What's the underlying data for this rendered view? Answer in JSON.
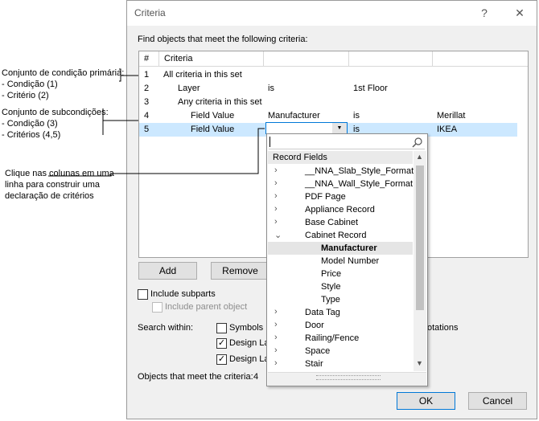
{
  "annotations": {
    "primary_set": {
      "title": "Conjunto de condição primária:",
      "line1": "- Condição (1)",
      "line2": "- Critério (2)"
    },
    "sub_set": {
      "title": "Conjunto de subcondições:",
      "line1": "- Condição (3)",
      "line2": "- Critérios (4,5)"
    },
    "click_note": {
      "line1": "Clique nas colunas em uma",
      "line2": "linha para construir uma",
      "line3": "declaração de critérios"
    }
  },
  "dialog": {
    "title": "Criteria",
    "help_glyph": "?",
    "close_glyph": "✕",
    "instruction": "Find objects that meet the following criteria:",
    "columns": [
      "#",
      "Criteria",
      "",
      "",
      ""
    ],
    "rows": [
      {
        "num": "1",
        "c1": "All criteria in this set",
        "c2": "",
        "c3": "",
        "c4": ""
      },
      {
        "num": "2",
        "c1": "Layer",
        "c2": "is",
        "c3": "1st Floor",
        "c4": ""
      },
      {
        "num": "3",
        "c1": "Any criteria in this set",
        "c2": "",
        "c3": "",
        "c4": ""
      },
      {
        "num": "4",
        "c1": "Field Value",
        "c2": "Manufacturer",
        "c3": "is",
        "c4": "Merillat"
      },
      {
        "num": "5",
        "c1": "Field Value",
        "c2": "",
        "c3": "is",
        "c4": "IKEA"
      }
    ],
    "add_label": "Add",
    "remove_label": "Remove",
    "include_subparts": "Include subparts",
    "include_parent": "Include parent object",
    "search_within": "Search within:",
    "symbols": "Symbols",
    "design_layers_1": "Design La",
    "design_layers_2": "Design La",
    "annotations_partial": "otations",
    "count_label": "Objects that meet the criteria:",
    "count_value": "4",
    "ok_label": "OK",
    "cancel_label": "Cancel"
  },
  "dropdown": {
    "search_value": "",
    "header": "Record Fields",
    "items": [
      {
        "label": "__NNA_Slab_Style_Format",
        "expander": "›"
      },
      {
        "label": "__NNA_Wall_Style_Format",
        "expander": "›"
      },
      {
        "label": "PDF Page",
        "expander": "›"
      },
      {
        "label": "Appliance Record",
        "expander": "›"
      },
      {
        "label": "Base Cabinet",
        "expander": "›"
      },
      {
        "label": "Cabinet Record",
        "expander": "⌄"
      },
      {
        "label": "Manufacturer",
        "expander": ""
      },
      {
        "label": "Model Number",
        "expander": ""
      },
      {
        "label": "Price",
        "expander": ""
      },
      {
        "label": "Style",
        "expander": ""
      },
      {
        "label": "Type",
        "expander": ""
      },
      {
        "label": "Data Tag",
        "expander": "›"
      },
      {
        "label": "Door",
        "expander": "›"
      },
      {
        "label": "Railing/Fence",
        "expander": "›"
      },
      {
        "label": "Space",
        "expander": "›"
      },
      {
        "label": "Stair",
        "expander": "›"
      }
    ]
  }
}
